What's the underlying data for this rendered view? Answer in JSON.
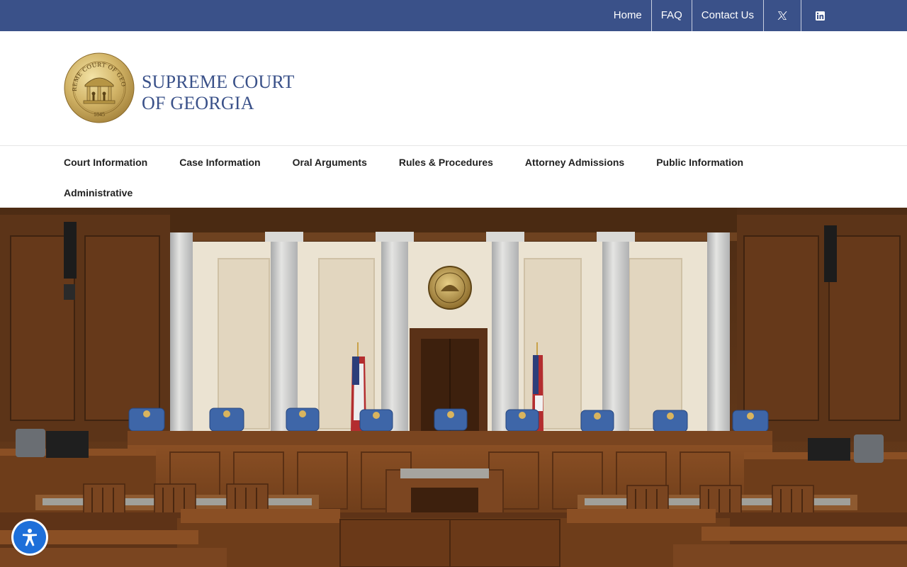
{
  "topbar": {
    "links": [
      {
        "label": "Home"
      },
      {
        "label": "FAQ"
      },
      {
        "label": "Contact Us"
      }
    ],
    "social": [
      {
        "icon": "x-twitter-icon"
      },
      {
        "icon": "linkedin-icon"
      }
    ],
    "background_color": "#3a5189"
  },
  "header": {
    "title_line1": "SUPREME COURT",
    "title_line2": "OF GEORGIA",
    "seal_text": "SUPREME COURT OF GEORGIA",
    "seal_year": "1845",
    "brand_color": "#3a5189"
  },
  "mainnav": {
    "items": [
      {
        "label": "Court Information"
      },
      {
        "label": "Case Information"
      },
      {
        "label": "Oral Arguments"
      },
      {
        "label": "Rules & Procedures"
      },
      {
        "label": "Attorney Admissions"
      },
      {
        "label": "Public Information"
      },
      {
        "label": "Administrative"
      }
    ]
  },
  "hero": {
    "image": "courtroom-photo"
  },
  "accessibility": {
    "icon": "accessibility-icon",
    "color": "#1e6fd9"
  }
}
